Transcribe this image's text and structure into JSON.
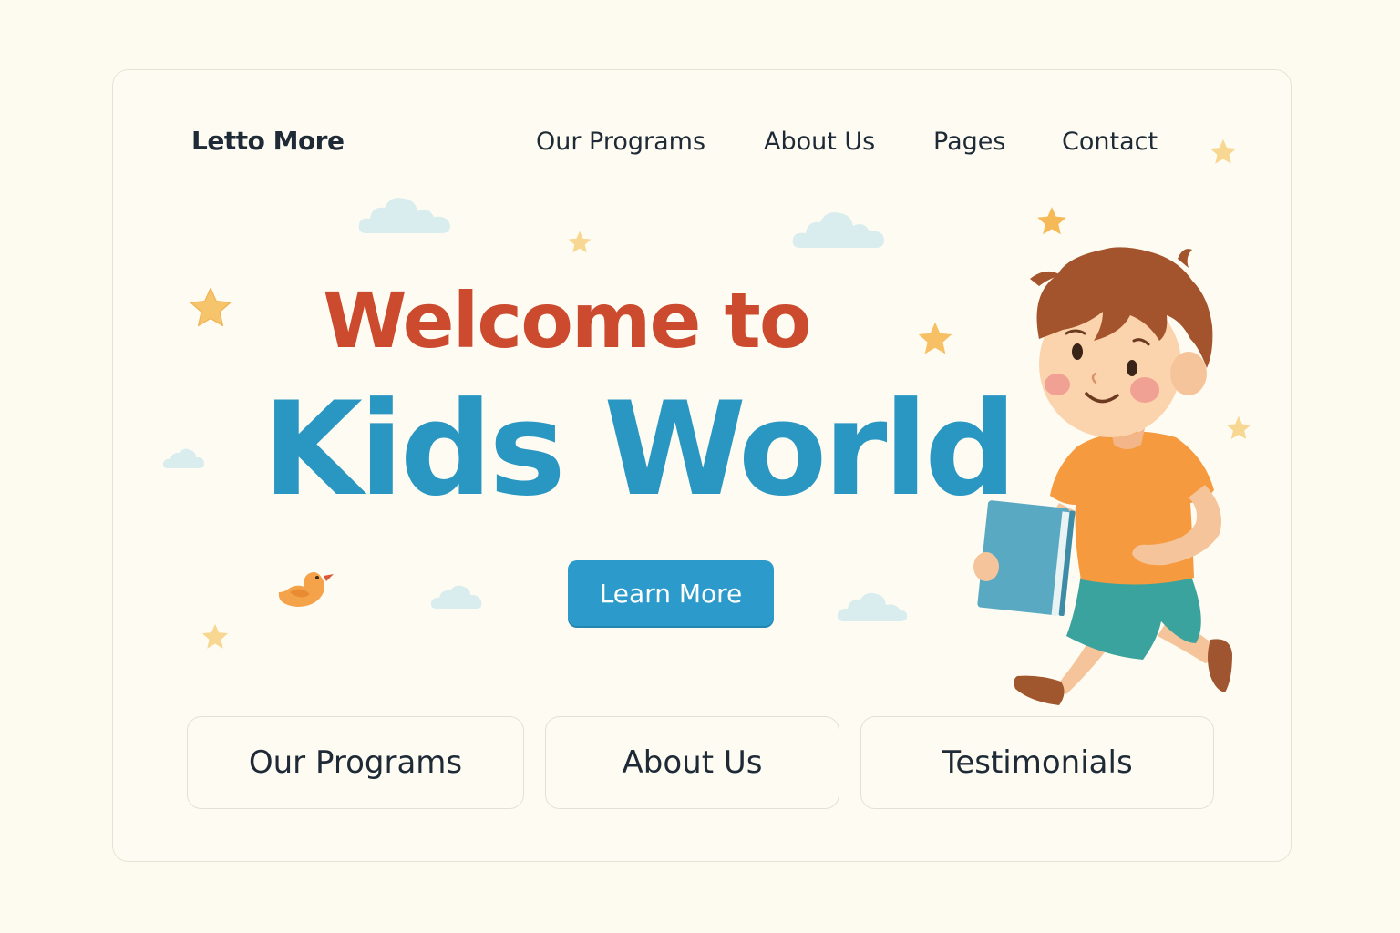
{
  "brand": {
    "name": "Letto More"
  },
  "nav": {
    "items": [
      {
        "label": "Our Programs"
      },
      {
        "label": "About Us"
      },
      {
        "label": "Pages"
      },
      {
        "label": "Contact"
      }
    ]
  },
  "hero": {
    "headline_line1": "Welcome to",
    "headline_line2": "Kids World",
    "cta_label": "Learn More",
    "illustration": "running-boy-with-book"
  },
  "tiles": [
    {
      "label": "Our Programs"
    },
    {
      "label": "About Us"
    },
    {
      "label": "Testimonials"
    }
  ],
  "colors": {
    "background": "#fdfbef",
    "headline_red": "#cc4a2e",
    "headline_blue": "#2a97c3",
    "button_blue": "#2c9bcb",
    "star": "#f6c56b",
    "cloud": "#d9ecee"
  }
}
